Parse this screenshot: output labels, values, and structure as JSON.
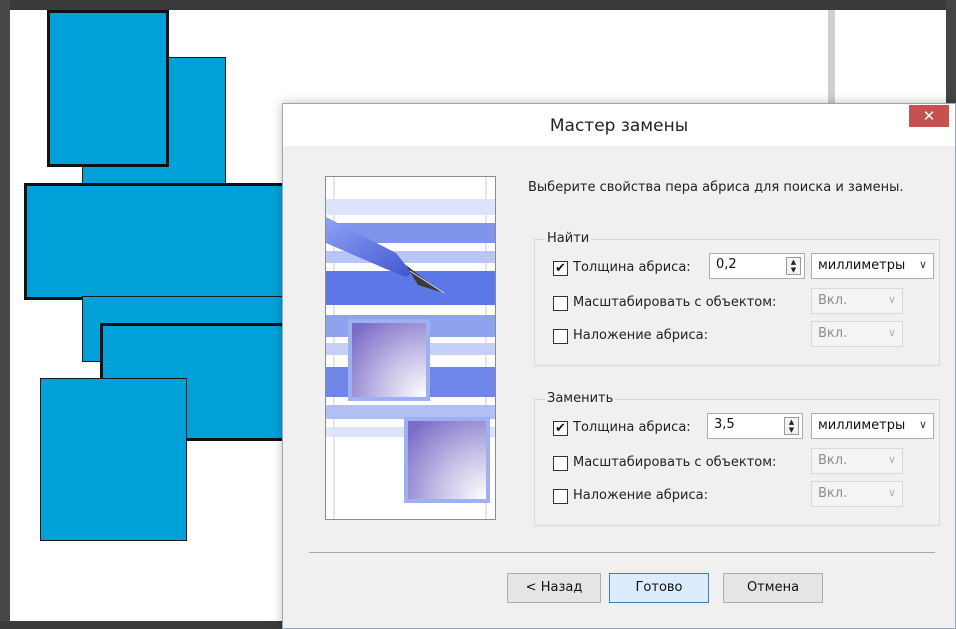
{
  "dialog": {
    "title": "Мастер замены",
    "close_label": "✕",
    "intro": "Выберите свойства пера абриса для поиска и замены.",
    "find": {
      "label": "Найти",
      "width_label": "Толщина абриса:",
      "width_checked": true,
      "width_value": "0,2",
      "unit": "миллиметры",
      "scale_label": "Масштабировать с объектом:",
      "scale_checked": false,
      "scale_value": "Вкл.",
      "overprint_label": "Наложение абриса:",
      "overprint_checked": false,
      "overprint_value": "Вкл."
    },
    "replace": {
      "label": "Заменить",
      "width_label": "Толщина абриса:",
      "width_checked": true,
      "width_value": "3,5",
      "unit": "миллиметры",
      "scale_label": "Масштабировать с объектом:",
      "scale_checked": false,
      "scale_value": "Вкл.",
      "overprint_label": "Наложение абриса:",
      "overprint_checked": false,
      "overprint_value": "Вкл."
    },
    "buttons": {
      "back": "< Назад",
      "finish": "Готово",
      "cancel": "Отмена"
    }
  },
  "icons": {
    "check": "✔",
    "chevron": "∨",
    "spin_up": "▲",
    "spin_down": "▼"
  },
  "colors": {
    "shape_fill": "#00a0d8",
    "close_button": "#c75050",
    "art_blue": "#5b78e6"
  }
}
